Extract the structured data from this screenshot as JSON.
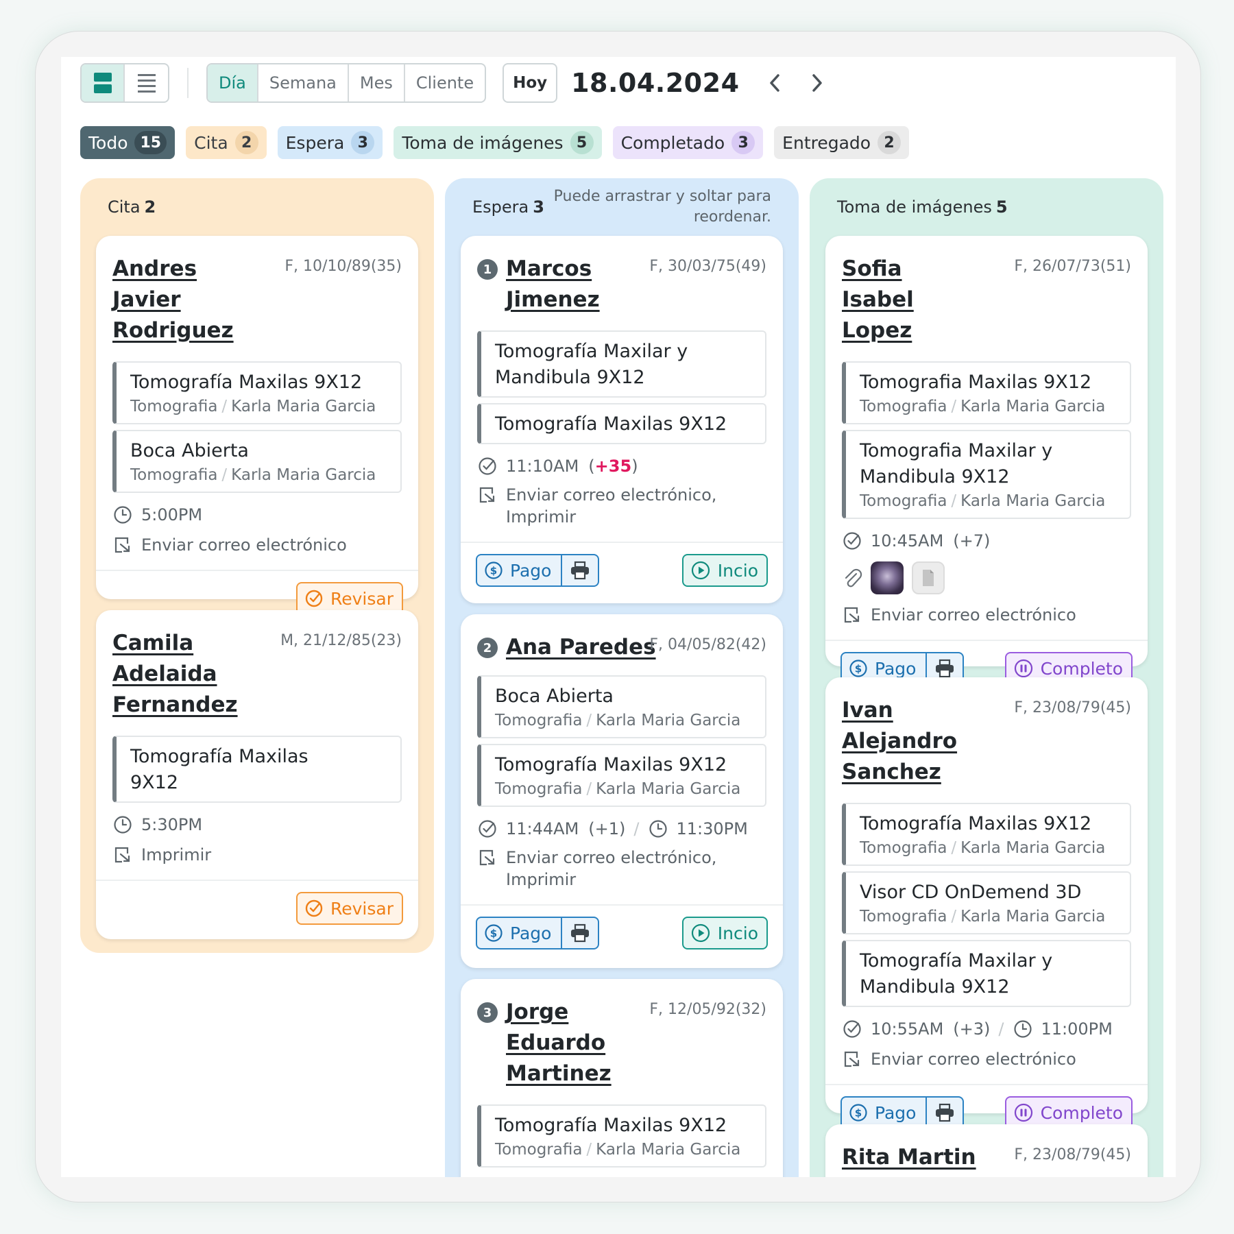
{
  "toolbar": {
    "views": [
      "board-view-icon",
      "list-view-icon"
    ],
    "periods": [
      {
        "label": "Día",
        "active": true
      },
      {
        "label": "Semana",
        "active": false
      },
      {
        "label": "Mes",
        "active": false
      },
      {
        "label": "Cliente",
        "active": false
      }
    ],
    "today_label": "Hoy",
    "date": "18.04.2024"
  },
  "filters": [
    {
      "label": "Todo",
      "count": "15"
    },
    {
      "label": "Cita",
      "count": "2"
    },
    {
      "label": "Espera",
      "count": "3"
    },
    {
      "label": "Toma de imágenes",
      "count": "5"
    },
    {
      "label": "Completado",
      "count": "3"
    },
    {
      "label": "Entregado",
      "count": "2"
    }
  ],
  "columns": {
    "cita": {
      "title": "Cita",
      "count": "2",
      "cards": [
        {
          "name": "Andres Javier Rodriguez",
          "meta": "F, 10/10/89(35)",
          "services": [
            {
              "title": "Tomografía Maxilas 9X12",
              "type": "Tomografia",
              "doctor": "Karla Maria Garcia"
            },
            {
              "title": "Boca Abierta",
              "type": "Tomografia",
              "doctor": "Karla Maria Garcia"
            }
          ],
          "time": "5:00PM",
          "delivery": "Enviar correo electrónico",
          "action": "Revisar"
        },
        {
          "name": "Camila Adelaida Fernandez",
          "meta": "M, 21/12/85(23)",
          "services": [
            {
              "title": "Tomografía Maxilas 9X12"
            }
          ],
          "time": "5:30PM",
          "delivery": "Imprimir",
          "action": "Revisar"
        }
      ]
    },
    "espera": {
      "title": "Espera",
      "count": "3",
      "hint": "Puede arrastrar y soltar para reordenar.",
      "cards": [
        {
          "order": "1",
          "name": "Marcos Jimenez",
          "meta": "F, 30/03/75(49)",
          "services": [
            {
              "title": "Tomografía Maxilar y Mandibula 9X12"
            },
            {
              "title": "Tomografía Maxilas 9X12"
            }
          ],
          "checkin": "11:10AM",
          "wait_open": "(",
          "wait": "+35",
          "wait_close": ")",
          "delivery": "Enviar correo electrónico, Imprimir",
          "pay_label": "Pago",
          "action": "Incio"
        },
        {
          "order": "2",
          "name": "Ana Paredes",
          "meta": "F, 04/05/82(42)",
          "services": [
            {
              "title": "Boca Abierta",
              "type": "Tomografia",
              "doctor": "Karla Maria Garcia"
            },
            {
              "title": "Tomografía Maxilas 9X12",
              "type": "Tomografia",
              "doctor": "Karla Maria Garcia"
            }
          ],
          "checkin": "11:44AM",
          "wait": "(+1)",
          "scheduled": "11:30PM",
          "delivery": "Enviar correo electrónico, Imprimir",
          "pay_label": "Pago",
          "action": "Incio"
        },
        {
          "order": "3",
          "name": "Jorge Eduardo Martinez",
          "meta": "F, 12/05/92(32)",
          "services": [
            {
              "title": "Tomografía Maxilas 9X12",
              "type": "Tomografia",
              "doctor": "Karla Maria Garcia"
            }
          ]
        }
      ]
    },
    "toma": {
      "title": "Toma de imágenes",
      "count": "5",
      "cards": [
        {
          "name": "Sofia Isabel Lopez",
          "meta": "F, 26/07/73(51)",
          "services": [
            {
              "title": "Tomografia Maxilas 9X12",
              "type": "Tomografia",
              "doctor": "Karla Maria Garcia"
            },
            {
              "title": "Tomografia Maxilar y Mandibula 9X12",
              "type": "Tomografia",
              "doctor": "Karla Maria Garcia"
            }
          ],
          "checkin": "10:45AM",
          "wait": "(+7)",
          "attachments": [
            "xray-thumbnail",
            "document-icon"
          ],
          "delivery": "Enviar correo electrónico",
          "pay_label": "Pago",
          "action": "Completo"
        },
        {
          "name": "Ivan Alejandro Sanchez",
          "meta": "F, 23/08/79(45)",
          "services": [
            {
              "title": "Tomografía Maxilas 9X12",
              "type": "Tomografia",
              "doctor": "Karla Maria Garcia"
            },
            {
              "title": "Visor CD OnDemend 3D",
              "type": "Tomografia",
              "doctor": "Karla Maria Garcia"
            },
            {
              "title": "Tomografía Maxilar y Mandibula 9X12"
            }
          ],
          "checkin": "10:55AM",
          "wait": "(+3)",
          "scheduled": "11:00PM",
          "delivery": "Enviar correo electrónico",
          "pay_label": "Pago",
          "action": "Completo"
        },
        {
          "name": "Rita Martin",
          "meta": "F, 23/08/79(45)"
        }
      ]
    }
  },
  "colors": {
    "accent_teal": "#0f8a7c",
    "cita_bg": "#fde9cc",
    "espera_bg": "#d6e9fa",
    "toma_bg": "#d6f0e8",
    "revisar": "#ef7f16",
    "pago": "#1c6fae",
    "completo": "#8146cc",
    "wait_highlight": "#e0185e"
  }
}
